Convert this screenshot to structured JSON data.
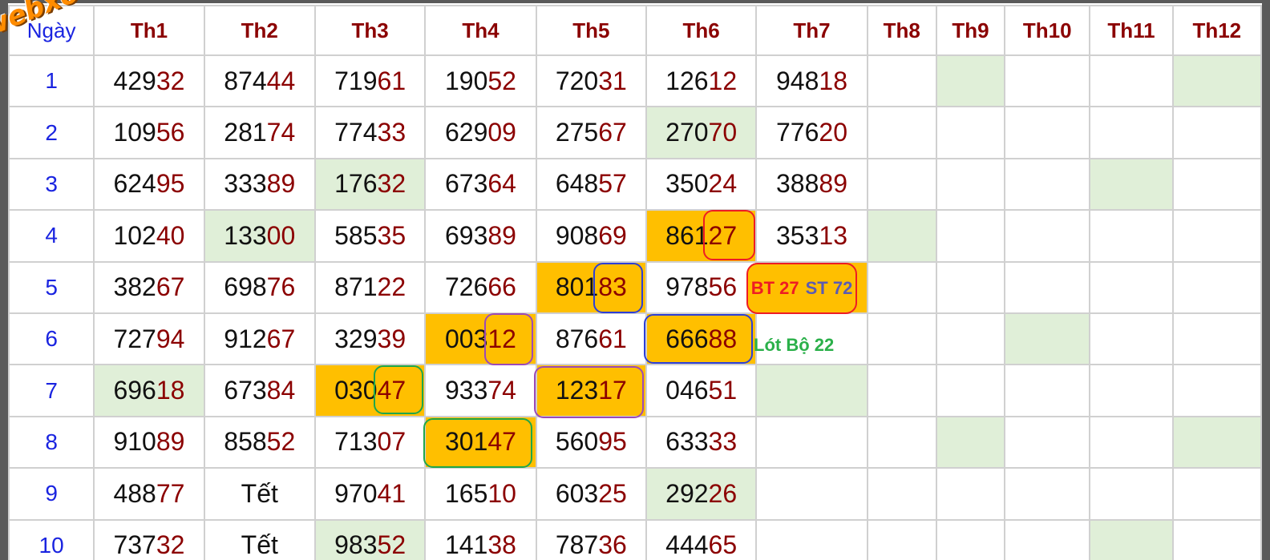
{
  "watermark": "webxoso.net",
  "header": {
    "day_label": "Ngày",
    "months": [
      "Th1",
      "Th2",
      "Th3",
      "Th4",
      "Th5",
      "Th6",
      "Th7",
      "Th8",
      "Th9",
      "Th10",
      "Th11",
      "Th12"
    ]
  },
  "colors": {
    "green_cell": "#e0efd8",
    "highlight_cell": "#ffbf00",
    "month_text": "#8b0000",
    "day_text": "#1a24e0",
    "last_two_digits": "#8b0000"
  },
  "rows": [
    {
      "day": "1",
      "cells": [
        {
          "hi": "429",
          "lo": "32"
        },
        {
          "hi": "874",
          "lo": "44"
        },
        {
          "hi": "719",
          "lo": "61"
        },
        {
          "hi": "190",
          "lo": "52"
        },
        {
          "hi": "720",
          "lo": "31"
        },
        {
          "hi": "126",
          "lo": "12"
        },
        {
          "hi": "948",
          "lo": "18"
        }
      ]
    },
    {
      "day": "2",
      "cells": [
        {
          "hi": "109",
          "lo": "56"
        },
        {
          "hi": "281",
          "lo": "74"
        },
        {
          "hi": "774",
          "lo": "33"
        },
        {
          "hi": "629",
          "lo": "09"
        },
        {
          "hi": "275",
          "lo": "67"
        },
        {
          "hi": "270",
          "lo": "70"
        },
        {
          "hi": "776",
          "lo": "20"
        }
      ]
    },
    {
      "day": "3",
      "cells": [
        {
          "hi": "624",
          "lo": "95"
        },
        {
          "hi": "333",
          "lo": "89"
        },
        {
          "hi": "176",
          "lo": "32"
        },
        {
          "hi": "673",
          "lo": "64"
        },
        {
          "hi": "648",
          "lo": "57"
        },
        {
          "hi": "350",
          "lo": "24"
        },
        {
          "hi": "388",
          "lo": "89"
        }
      ]
    },
    {
      "day": "4",
      "cells": [
        {
          "hi": "102",
          "lo": "40"
        },
        {
          "hi": "133",
          "lo": "00"
        },
        {
          "hi": "585",
          "lo": "35"
        },
        {
          "hi": "693",
          "lo": "89"
        },
        {
          "hi": "908",
          "lo": "69"
        },
        {
          "hi": "861",
          "lo": "27"
        },
        {
          "hi": "353",
          "lo": "13"
        }
      ]
    },
    {
      "day": "5",
      "cells": [
        {
          "hi": "382",
          "lo": "67"
        },
        {
          "hi": "698",
          "lo": "76"
        },
        {
          "hi": "871",
          "lo": "22"
        },
        {
          "hi": "726",
          "lo": "66"
        },
        {
          "hi": "801",
          "lo": "83"
        },
        {
          "hi": "978",
          "lo": "56"
        }
      ]
    },
    {
      "day": "6",
      "cells": [
        {
          "hi": "727",
          "lo": "94"
        },
        {
          "hi": "912",
          "lo": "67"
        },
        {
          "hi": "329",
          "lo": "39"
        },
        {
          "hi": "003",
          "lo": "12"
        },
        {
          "hi": "876",
          "lo": "61"
        },
        {
          "hi": "666",
          "lo": "88"
        }
      ]
    },
    {
      "day": "7",
      "cells": [
        {
          "hi": "696",
          "lo": "18"
        },
        {
          "hi": "673",
          "lo": "84"
        },
        {
          "hi": "030",
          "lo": "47"
        },
        {
          "hi": "933",
          "lo": "74"
        },
        {
          "hi": "123",
          "lo": "17"
        },
        {
          "hi": "046",
          "lo": "51"
        }
      ]
    },
    {
      "day": "8",
      "cells": [
        {
          "hi": "910",
          "lo": "89"
        },
        {
          "hi": "858",
          "lo": "52"
        },
        {
          "hi": "713",
          "lo": "07"
        },
        {
          "hi": "301",
          "lo": "47"
        },
        {
          "hi": "560",
          "lo": "95"
        },
        {
          "hi": "633",
          "lo": "33"
        }
      ]
    },
    {
      "day": "9",
      "cells": [
        {
          "hi": "488",
          "lo": "77"
        },
        {
          "text": "Tết"
        },
        {
          "hi": "970",
          "lo": "41"
        },
        {
          "hi": "165",
          "lo": "10"
        },
        {
          "hi": "603",
          "lo": "25"
        },
        {
          "hi": "292",
          "lo": "26"
        }
      ]
    },
    {
      "day": "10",
      "cells": [
        {
          "hi": "737",
          "lo": "32"
        },
        {
          "text": "Tết"
        },
        {
          "hi": "983",
          "lo": "52"
        },
        {
          "hi": "141",
          "lo": "38"
        },
        {
          "hi": "787",
          "lo": "36"
        },
        {
          "hi": "444",
          "lo": "65"
        }
      ]
    }
  ],
  "annotations": {
    "bt_label": "BT 27",
    "st_label": "ST 72",
    "lot_label": "Lót Bộ 22"
  }
}
